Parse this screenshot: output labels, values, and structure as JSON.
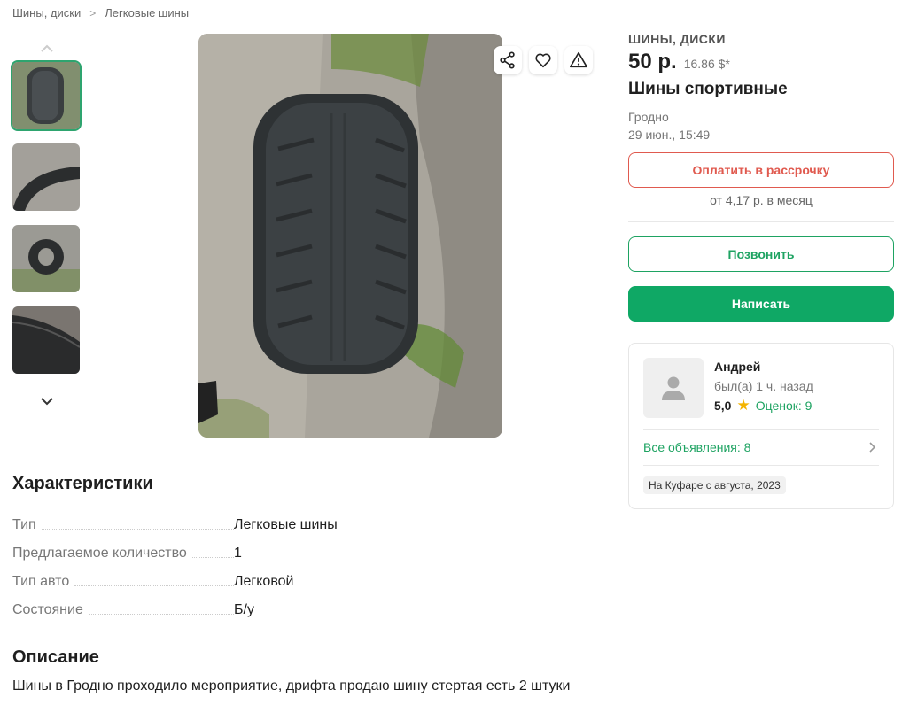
{
  "breadcrumb": {
    "items": [
      "Шины, диски",
      "Легковые шины"
    ],
    "separator": ">"
  },
  "gallery": {
    "thumb_count": 4,
    "active_index": 0
  },
  "listing": {
    "category": "ШИНЫ, ДИСКИ",
    "price": "50 р.",
    "price_usd": "16.86 $*",
    "title": "Шины спортивные",
    "city": "Гродно",
    "date": "29 июн., 15:49"
  },
  "actions": {
    "installment_label": "Оплатить в рассрочку",
    "installment_note": "от 4,17 р. в месяц",
    "call_label": "Позвонить",
    "write_label": "Написать"
  },
  "seller": {
    "name": "Андрей",
    "last_seen": "был(а) 1 ч. назад",
    "rating": "5,0",
    "reviews": "Оценок: 9",
    "all_ads": "Все объявления: 8",
    "since": "На Куфаре с августа, 2023"
  },
  "characteristics": {
    "title": "Характеристики",
    "rows": [
      {
        "key": "Тип",
        "value": "Легковые шины"
      },
      {
        "key": "Предлагаемое количество",
        "value": "1"
      },
      {
        "key": "Тип авто",
        "value": "Легковой"
      },
      {
        "key": "Состояние",
        "value": "Б/у"
      }
    ]
  },
  "description": {
    "title": "Описание",
    "text": "Шины в Гродно проходило мероприятие, дрифта продаю шину стертая есть 2 штуки"
  },
  "colors": {
    "accent_green": "#0fa865",
    "installment_red": "#e05a4f",
    "star": "#f4b400"
  }
}
